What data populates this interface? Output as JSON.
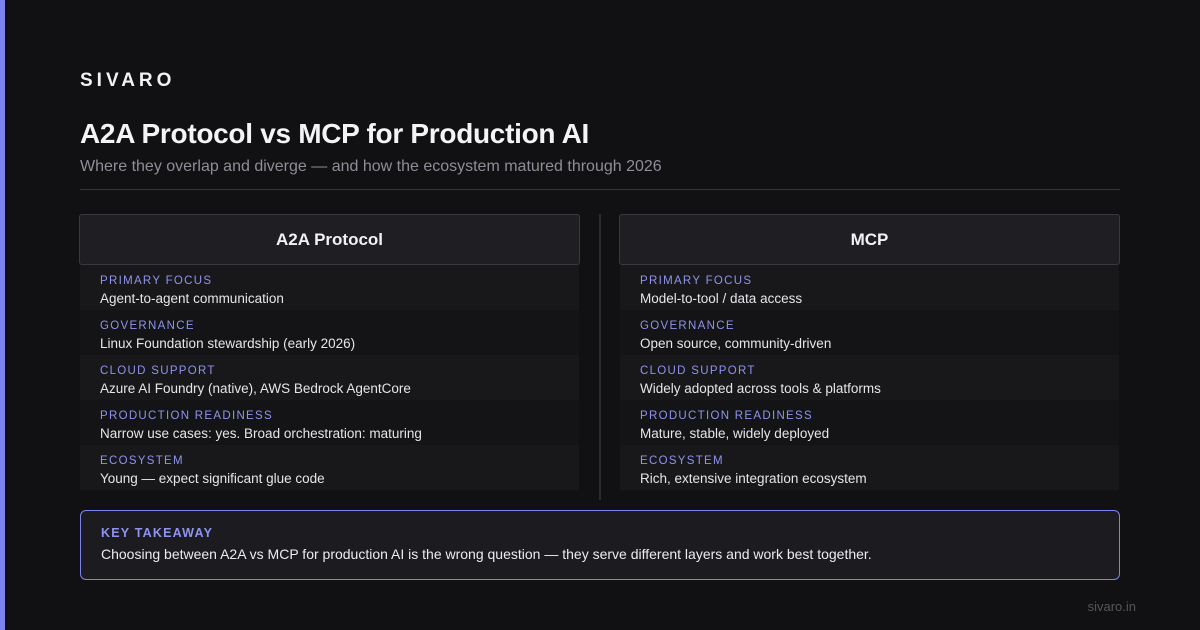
{
  "brand": "SIVARO",
  "title": "A2A Protocol vs MCP for Production AI",
  "subtitle": "Where they overlap and diverge — and how the ecosystem matured through 2026",
  "colors": {
    "background": "#111113",
    "accent": "#7c83f0",
    "label": "#8f93ef"
  },
  "columns": [
    {
      "header": "A2A Protocol",
      "rows": [
        {
          "label": "PRIMARY FOCUS",
          "value": "Agent-to-agent communication"
        },
        {
          "label": "GOVERNANCE",
          "value": "Linux Foundation stewardship (early 2026)"
        },
        {
          "label": "CLOUD SUPPORT",
          "value": "Azure AI Foundry (native), AWS Bedrock AgentCore"
        },
        {
          "label": "PRODUCTION READINESS",
          "value": "Narrow use cases: yes. Broad orchestration: maturing"
        },
        {
          "label": "ECOSYSTEM",
          "value": "Young — expect significant glue code"
        }
      ]
    },
    {
      "header": "MCP",
      "rows": [
        {
          "label": "PRIMARY FOCUS",
          "value": "Model-to-tool / data access"
        },
        {
          "label": "GOVERNANCE",
          "value": "Open source, community-driven"
        },
        {
          "label": "CLOUD SUPPORT",
          "value": "Widely adopted across tools & platforms"
        },
        {
          "label": "PRODUCTION READINESS",
          "value": "Mature, stable, widely deployed"
        },
        {
          "label": "ECOSYSTEM",
          "value": "Rich, extensive integration ecosystem"
        }
      ]
    }
  ],
  "takeaway": {
    "label": "KEY TAKEAWAY",
    "text": "Choosing between A2A vs MCP for production AI is the wrong question — they serve different layers and work best together."
  },
  "footer": "sivaro.in"
}
